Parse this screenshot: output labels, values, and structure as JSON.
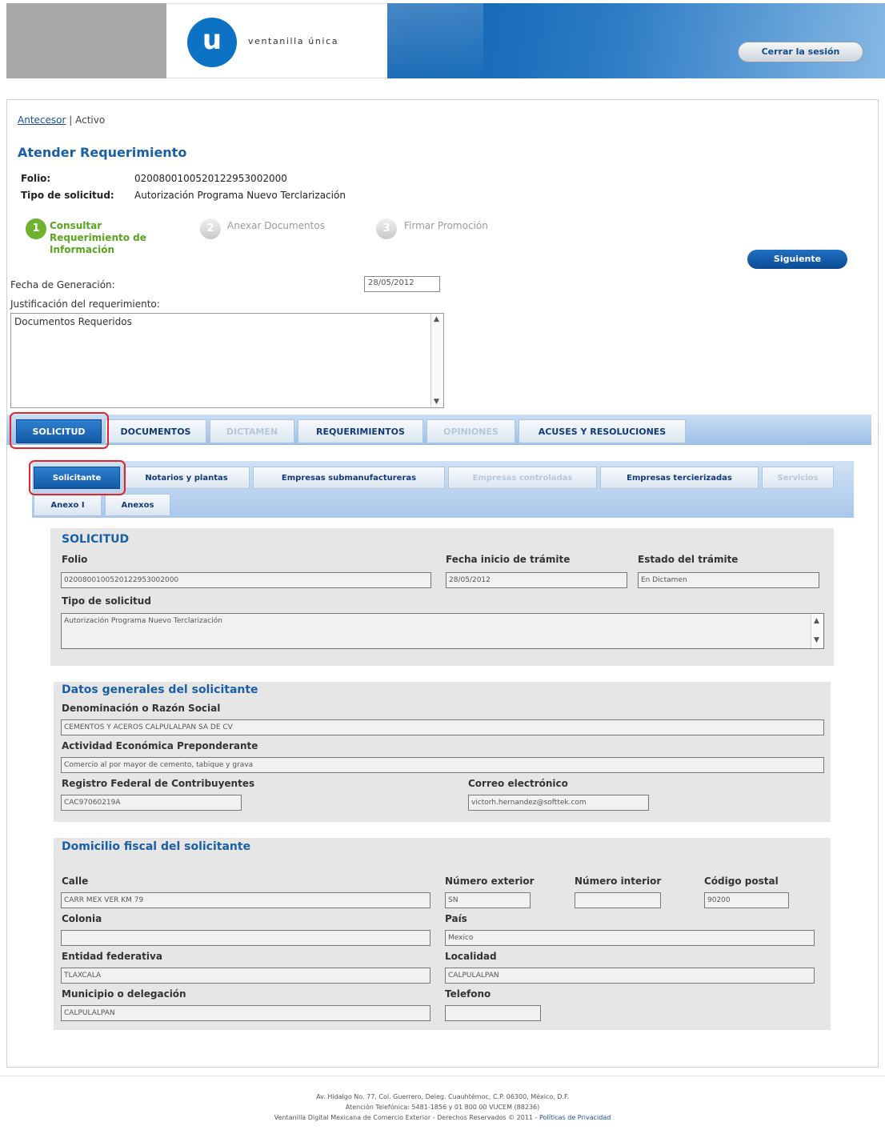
{
  "header": {
    "logo_letter": "u",
    "logo_text": "ventanilla única",
    "logout_label": "Cerrar la sesión"
  },
  "breadcrumb": {
    "parent": "Antecesor",
    "separator": "|",
    "current": "Activo"
  },
  "page_title": "Atender Requerimiento",
  "info": {
    "folio_label": "Folio:",
    "folio_value": "0200800100520122953002000",
    "tipo_label": "Tipo de solicitud:",
    "tipo_value": "Autorización Programa Nuevo Terclarización"
  },
  "steps": [
    {
      "num": "1",
      "label": "Consultar Requerimiento de Información",
      "active": true
    },
    {
      "num": "2",
      "label": "Anexar Documentos",
      "active": false
    },
    {
      "num": "3",
      "label": "Firmar Promoción",
      "active": false
    }
  ],
  "next_label": "Siguiente",
  "fecha_label": "Fecha de Generación:",
  "fecha_value": "28/05/2012",
  "justificacion_label": "Justificación del requerimiento:",
  "justificacion_value": "Documentos Requeridos",
  "main_tabs": [
    "SOLICITUD",
    "DOCUMENTOS",
    "DICTAMEN",
    "REQUERIMIENTOS",
    "OPINIONES",
    "ACUSES Y RESOLUCIONES"
  ],
  "sub_tabs": [
    "Solicitante",
    "Notarios y plantas",
    "Empresas submanufactureras",
    "Empresas controladas",
    "Empresas tercierizadas",
    "Servicios",
    "Anexo I",
    "Anexos"
  ],
  "solicitud": {
    "title": "SOLICITUD",
    "folio_label": "Folio",
    "folio_value": "0200800100520122953002000",
    "fecha_label": "Fecha inicio de trámite",
    "fecha_value": "28/05/2012",
    "estado_label": "Estado del trámite",
    "estado_value": "En Dictamen",
    "tipo_label": "Tipo de solicitud",
    "tipo_value": "Autorización Programa Nuevo Terclarización"
  },
  "datos": {
    "title": "Datos generales del solicitante",
    "razon_label": "Denominación o Razón Social",
    "razon_value": "CEMENTOS Y ACEROS CALPULALPAN SA DE CV",
    "actividad_label": "Actividad Económica Preponderante",
    "actividad_value": "Comercio al por mayor de cemento, tabique y grava",
    "rfc_label": "Registro Federal de Contribuyentes",
    "rfc_value": "CAC97060219A",
    "correo_label": "Correo electrónico",
    "correo_value": "victorh.hernandez@softtek.com"
  },
  "domicilio": {
    "title": "Domicilio fiscal del solicitante",
    "calle_label": "Calle",
    "calle_value": "CARR MEX VER KM 79",
    "num_ext_label": "Número exterior",
    "num_ext_value": "SN",
    "num_int_label": "Número interior",
    "num_int_value": "",
    "cp_label": "Código postal",
    "cp_value": "90200",
    "colonia_label": "Colonia",
    "colonia_value": "",
    "pais_label": "País",
    "pais_value": "Mexico",
    "entidad_label": "Entidad federativa",
    "entidad_value": "TLAXCALA",
    "localidad_label": "Localidad",
    "localidad_value": "CALPULALPAN",
    "municipio_label": "Municipio o delegación",
    "municipio_value": "CALPULALPAN",
    "telefono_label": "Telefono",
    "telefono_value": ""
  },
  "footer": {
    "line1": "Av. Hidalgo No. 77, Col. Guerrero, Deleg. Cuauhtémoc, C.P. 06300, México, D.F.",
    "line2": "Atención Telefónica: 5481-1856 y 01 800 00 VUCEM (88236)",
    "line3": "Ventanilla Digital Mexicana de Comercio Exterior - Derechos Reservados © 2011 -",
    "privacy_link": "Políticas de Privacidad"
  }
}
